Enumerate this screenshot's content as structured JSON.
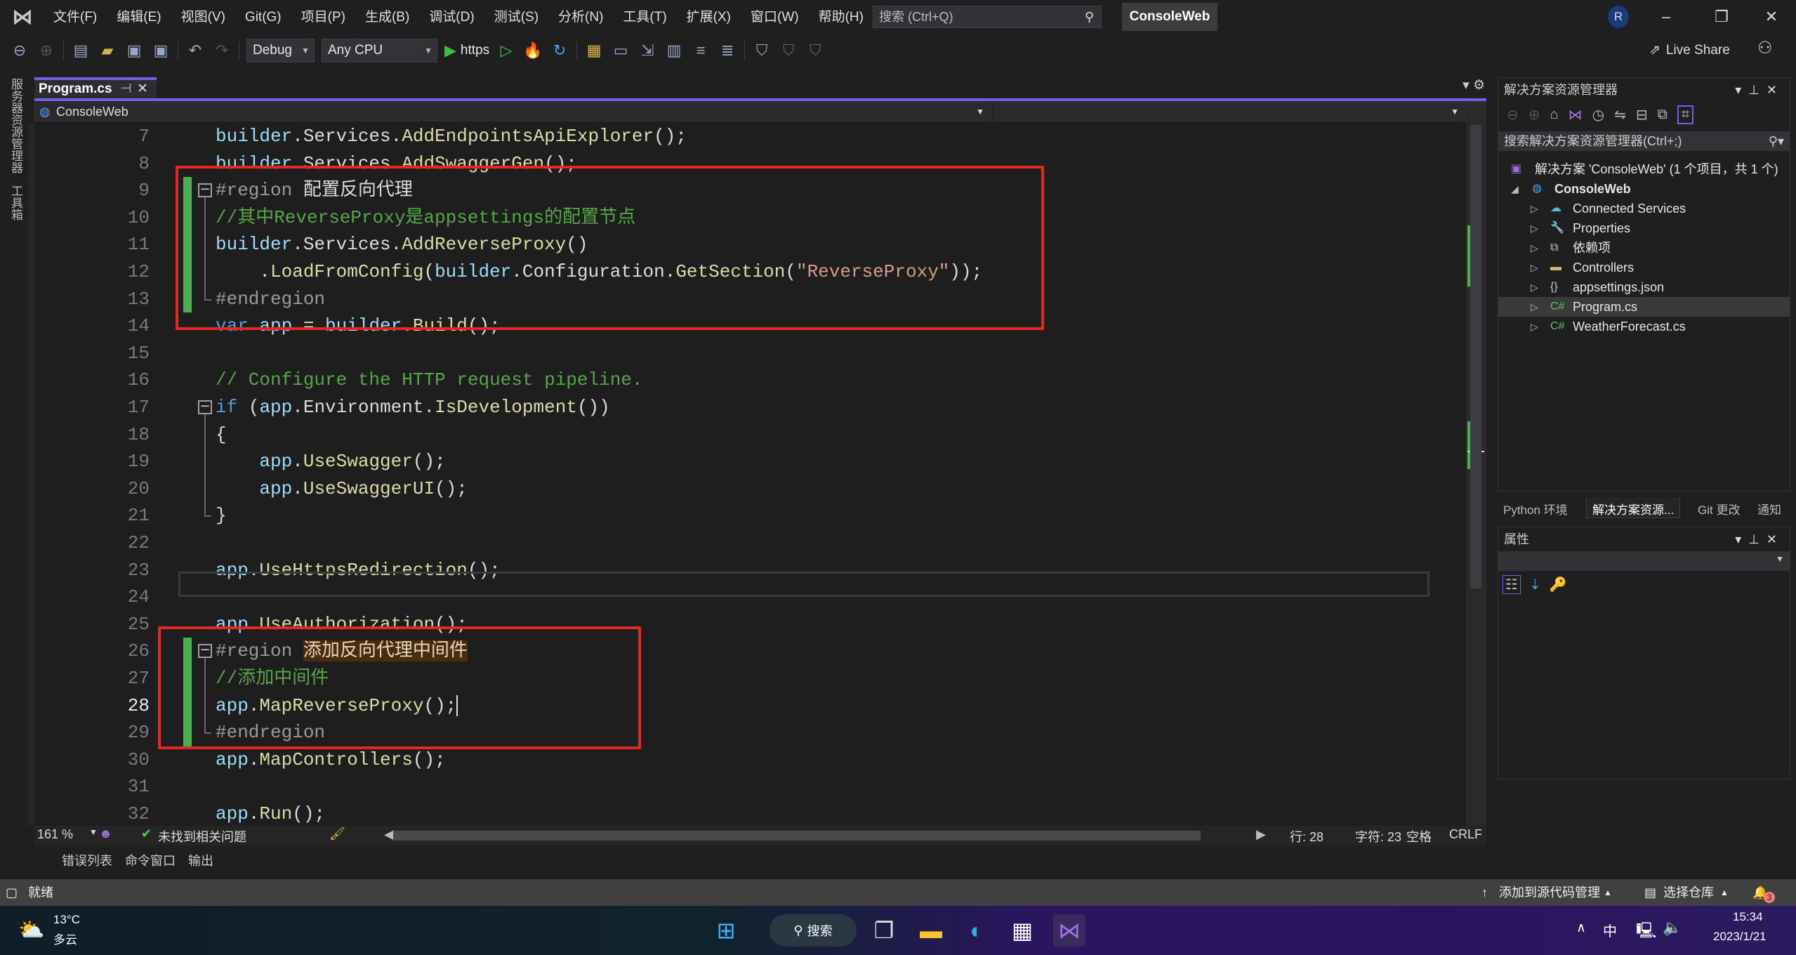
{
  "titlebar": {
    "menu": [
      "文件(F)",
      "编辑(E)",
      "视图(V)",
      "Git(G)",
      "项目(P)",
      "生成(B)",
      "调试(D)",
      "测试(S)",
      "分析(N)",
      "工具(T)",
      "扩展(X)",
      "窗口(W)",
      "帮助(H)"
    ],
    "search_placeholder": "搜索 (Ctrl+Q)",
    "solution_name": "ConsoleWeb",
    "avatar_initial": "R"
  },
  "toolbar": {
    "configuration": "Debug",
    "platform": "Any CPU",
    "run_profile": "https",
    "live_share": "Live Share"
  },
  "left_strip": [
    "服务器资源管理器",
    "工具箱"
  ],
  "editor": {
    "tab_label": "Program.cs",
    "nav_project": "ConsoleWeb",
    "current_line": 28,
    "lines": [
      {
        "n": 7,
        "tokens": [
          [
            "builder",
            "id"
          ],
          [
            ".Services.",
            "p"
          ],
          [
            "AddEndpointsApiExplorer",
            "m"
          ],
          [
            "();",
            "p"
          ]
        ]
      },
      {
        "n": 8,
        "tokens": [
          [
            "builder",
            "id"
          ],
          [
            ".Services.",
            "p"
          ],
          [
            "AddSwaggerGen",
            "m"
          ],
          [
            "();",
            "p"
          ]
        ]
      },
      {
        "n": 9,
        "tokens": [
          [
            "#region ",
            "r"
          ],
          [
            "配置反向代理",
            "p"
          ]
        ]
      },
      {
        "n": 10,
        "tokens": [
          [
            "//其中ReverseProxy是appsettings的配置节点",
            "c"
          ]
        ]
      },
      {
        "n": 11,
        "tokens": [
          [
            "builder",
            "id"
          ],
          [
            ".Services.",
            "p"
          ],
          [
            "AddReverseProxy",
            "m"
          ],
          [
            "()",
            "p"
          ]
        ]
      },
      {
        "n": 12,
        "tokens": [
          [
            "    .",
            "p"
          ],
          [
            "LoadFromConfig",
            "m"
          ],
          [
            "(",
            "p"
          ],
          [
            "builder",
            "id"
          ],
          [
            ".Configuration.",
            "p"
          ],
          [
            "GetSection",
            "m"
          ],
          [
            "(",
            "p"
          ],
          [
            "\"ReverseProxy\"",
            "s"
          ],
          [
            "));",
            "p"
          ]
        ]
      },
      {
        "n": 13,
        "tokens": [
          [
            "#endregion",
            "r"
          ]
        ]
      },
      {
        "n": 14,
        "tokens": [
          [
            "var",
            "k"
          ],
          [
            " ",
            "p"
          ],
          [
            "app",
            "id"
          ],
          [
            " = ",
            "p"
          ],
          [
            "builder",
            "id"
          ],
          [
            ".",
            "p"
          ],
          [
            "Build",
            "m"
          ],
          [
            "();",
            "p"
          ]
        ]
      },
      {
        "n": 15,
        "tokens": []
      },
      {
        "n": 16,
        "tokens": [
          [
            "// Configure the HTTP request pipeline.",
            "c"
          ]
        ]
      },
      {
        "n": 17,
        "tokens": [
          [
            "if",
            "k"
          ],
          [
            " (",
            "p"
          ],
          [
            "app",
            "id"
          ],
          [
            ".Environment.",
            "p"
          ],
          [
            "IsDevelopment",
            "m"
          ],
          [
            "())",
            "p"
          ]
        ]
      },
      {
        "n": 18,
        "tokens": [
          [
            "{",
            "p"
          ]
        ]
      },
      {
        "n": 19,
        "tokens": [
          [
            "    ",
            "p"
          ],
          [
            "app",
            "id"
          ],
          [
            ".",
            "p"
          ],
          [
            "UseSwagger",
            "m"
          ],
          [
            "();",
            "p"
          ]
        ]
      },
      {
        "n": 20,
        "tokens": [
          [
            "    ",
            "p"
          ],
          [
            "app",
            "id"
          ],
          [
            ".",
            "p"
          ],
          [
            "UseSwaggerUI",
            "m"
          ],
          [
            "();",
            "p"
          ]
        ]
      },
      {
        "n": 21,
        "tokens": [
          [
            "}",
            "p"
          ]
        ]
      },
      {
        "n": 22,
        "tokens": []
      },
      {
        "n": 23,
        "tokens": [
          [
            "app",
            "id"
          ],
          [
            ".",
            "p"
          ],
          [
            "UseHttpsRedirection",
            "m"
          ],
          [
            "();",
            "p"
          ]
        ]
      },
      {
        "n": 24,
        "tokens": []
      },
      {
        "n": 25,
        "tokens": [
          [
            "app",
            "id"
          ],
          [
            ".",
            "p"
          ],
          [
            "UseAuthorization",
            "m"
          ],
          [
            "();",
            "p"
          ]
        ]
      },
      {
        "n": 26,
        "tokens": [
          [
            "#region ",
            "r"
          ],
          [
            "添加反向代理中间件",
            "hl"
          ]
        ]
      },
      {
        "n": 27,
        "tokens": [
          [
            "//添加中间件",
            "c"
          ]
        ]
      },
      {
        "n": 28,
        "tokens": [
          [
            "app",
            "id"
          ],
          [
            ".",
            "p"
          ],
          [
            "MapReverseProxy",
            "m"
          ],
          [
            "();",
            "p"
          ]
        ]
      },
      {
        "n": 29,
        "tokens": [
          [
            "#endregion",
            "r"
          ]
        ]
      },
      {
        "n": 30,
        "tokens": [
          [
            "app",
            "id"
          ],
          [
            ".",
            "p"
          ],
          [
            "MapControllers",
            "m"
          ],
          [
            "();",
            "p"
          ]
        ]
      },
      {
        "n": 31,
        "tokens": []
      },
      {
        "n": 32,
        "tokens": [
          [
            "app",
            "id"
          ],
          [
            ".",
            "p"
          ],
          [
            "Run",
            "m"
          ],
          [
            "();",
            "p"
          ]
        ]
      }
    ],
    "status": {
      "zoom": "161 %",
      "issues": "未找到相关问题",
      "line": "行: 28",
      "char": "字符: 23",
      "indent": "空格",
      "eol": "CRLF"
    }
  },
  "bottom_tabs": [
    "错误列表",
    "命令窗口",
    "输出"
  ],
  "solution_explorer": {
    "title": "解决方案资源管理器",
    "search_placeholder": "搜索解决方案资源管理器(Ctrl+;)",
    "solution": "解决方案 'ConsoleWeb' (1 个项目，共 1 个)",
    "project": "ConsoleWeb",
    "items": [
      {
        "label": "Connected Services",
        "icon": "cloud-plug-icon",
        "glyph": "☁"
      },
      {
        "label": "Properties",
        "icon": "wrench-folder-icon",
        "glyph": "🔧"
      },
      {
        "label": "依赖项",
        "icon": "dependencies-icon",
        "glyph": "⧉"
      },
      {
        "label": "Controllers",
        "icon": "folder-icon",
        "glyph": "▬"
      },
      {
        "label": "appsettings.json",
        "icon": "json-file-icon",
        "glyph": "{}"
      },
      {
        "label": "Program.cs",
        "icon": "csharp-file-icon",
        "glyph": "C#",
        "selected": true
      },
      {
        "label": "WeatherForecast.cs",
        "icon": "csharp-file-icon",
        "glyph": "C#"
      }
    ]
  },
  "panel_tabs": [
    "Python 环境",
    "解决方案资源...",
    "Git 更改",
    "通知"
  ],
  "properties": {
    "title": "属性"
  },
  "statusbar": {
    "ready": "就绪",
    "add_source_control": "添加到源代码管理",
    "select_repo": "选择仓库",
    "notifications": "3"
  },
  "taskbar": {
    "temperature": "13°C",
    "weather": "多云",
    "search": "搜索",
    "ime": "中",
    "time": "15:34",
    "date": "2023/1/21"
  },
  "colors": {
    "accent": "#7160e8",
    "annotation_red": "#e8271e",
    "change_bar": "#4caf50"
  }
}
